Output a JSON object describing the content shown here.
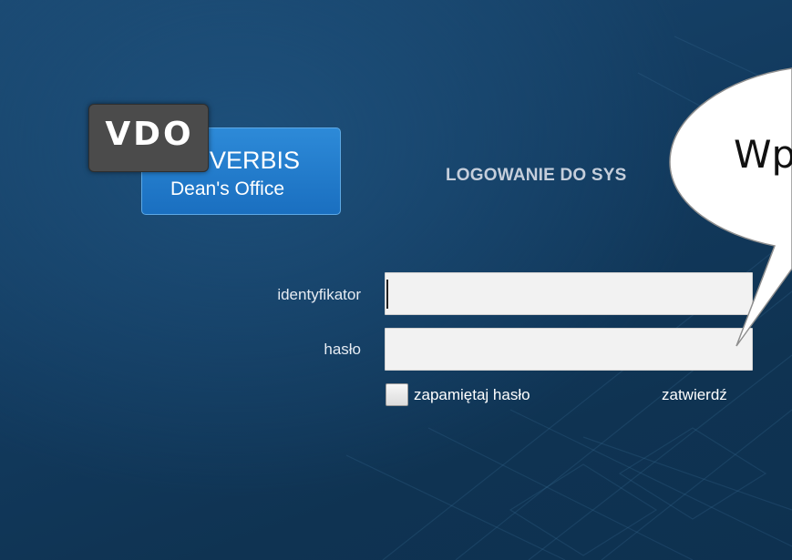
{
  "logo": {
    "badge": "VDO",
    "brand": "VERBIS",
    "subtitle": "Dean's Office"
  },
  "login": {
    "title": "LOGOWANIE DO SYS",
    "identifier_label": "identyfikator",
    "identifier_value": "",
    "password_label": "hasło",
    "password_value": "",
    "remember_label": "zapamiętaj hasło",
    "remember_checked": false,
    "submit_label": "zatwierdź"
  },
  "callout": {
    "text": "Wp"
  },
  "colors": {
    "background": "#133b5f",
    "logo_dark": "#4b4b4b",
    "logo_blue": "#1f78c8",
    "field_bg": "#f2f2f2"
  }
}
